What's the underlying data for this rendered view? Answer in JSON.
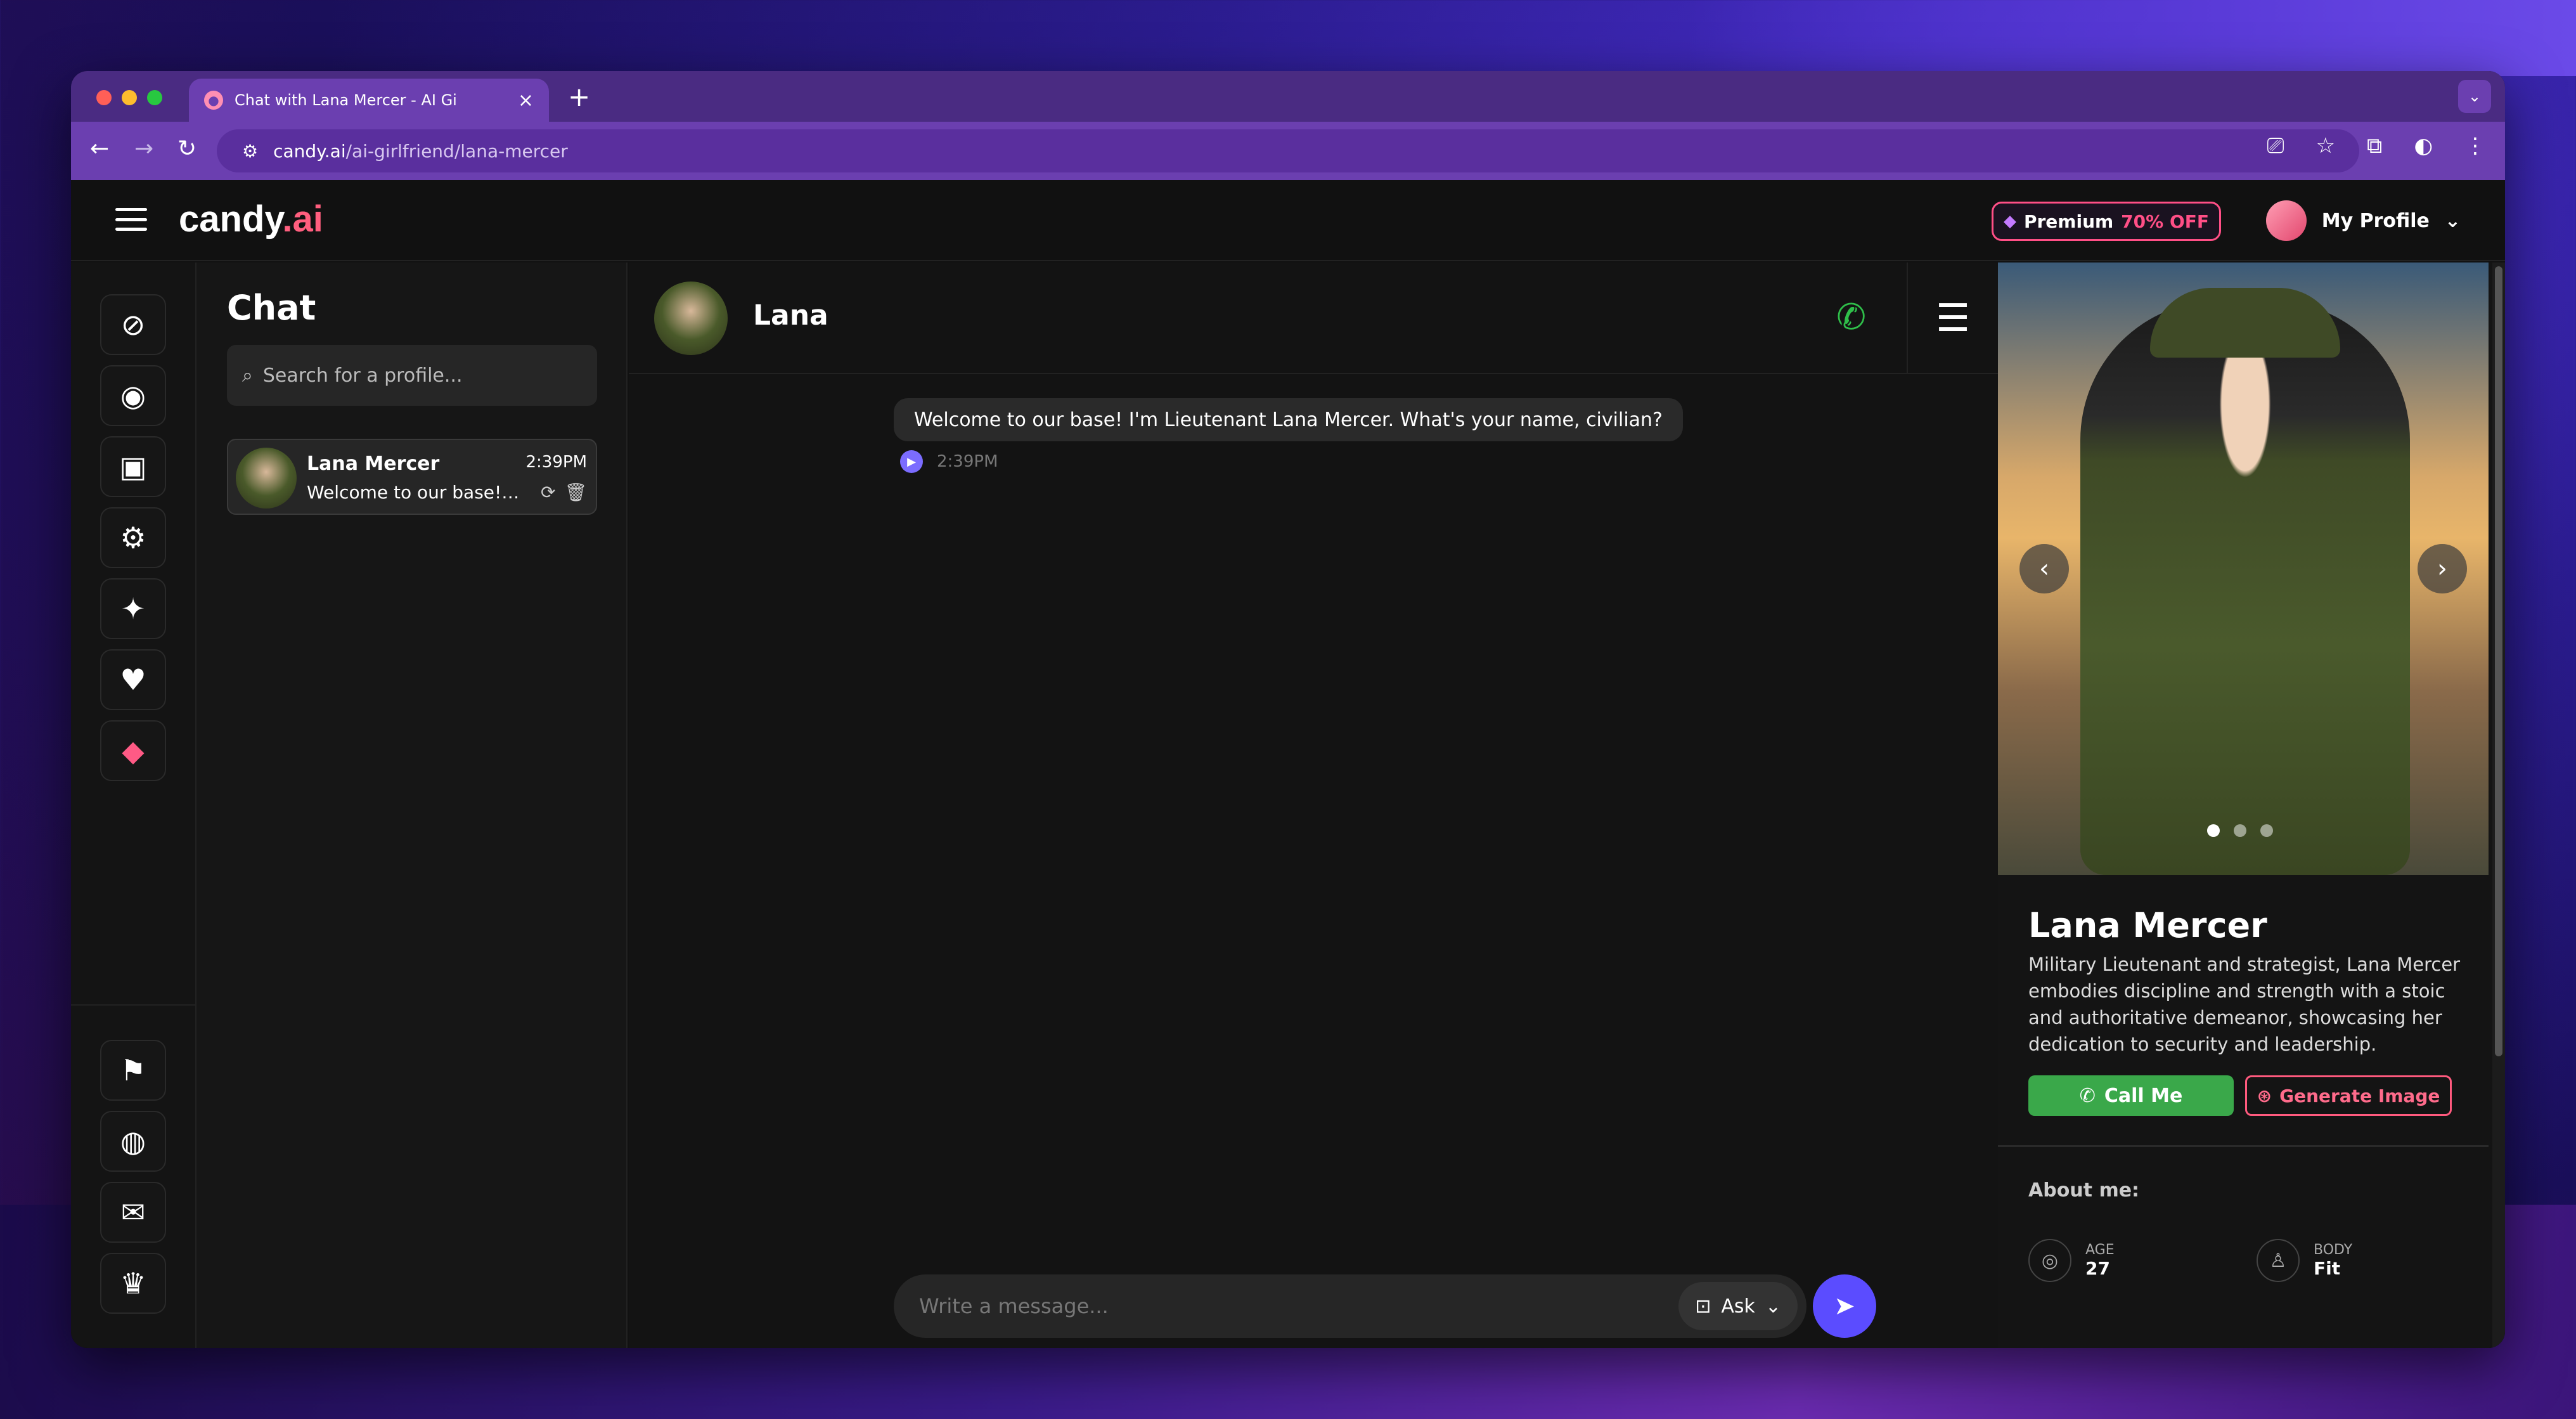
{
  "browser": {
    "tab_title": "Chat with Lana Mercer - AI Gi",
    "url_domain": "candy.ai",
    "url_path": "/ai-girlfriend/lana-mercer"
  },
  "topbar": {
    "logo_main": "candy",
    "logo_suffix": ".ai",
    "premium_label": "Premium",
    "premium_discount": "70% OFF",
    "profile_label": "My Profile"
  },
  "chatlist": {
    "heading": "Chat",
    "search_placeholder": "Search for a profile...",
    "items": [
      {
        "name": "Lana Mercer",
        "time": "2:39PM",
        "preview": "Welcome to our base! I'm Lieutenant Lana Mercer. What's your name, civilian?"
      }
    ]
  },
  "conversation": {
    "name": "Lana",
    "messages": [
      {
        "text": "Welcome to our base! I'm Lieutenant Lana Mercer. What's your name, civilian?",
        "time": "2:39PM"
      }
    ],
    "composer_placeholder": "Write a message...",
    "ask_label": "Ask"
  },
  "profile_panel": {
    "name": "Lana Mercer",
    "description": "Military Lieutenant and strategist, Lana Mercer embodies discipline and strength with a stoic and authoritative demeanor, showcasing her dedication to security and leadership.",
    "call_label": "Call Me",
    "generate_label": "Generate Image",
    "about_heading": "About me:",
    "attributes": [
      {
        "label": "AGE",
        "value": "27"
      },
      {
        "label": "BODY",
        "value": "Fit"
      }
    ]
  },
  "colors": {
    "accent_pink": "#ff5e7e",
    "call_green": "#2fbf4a",
    "send_blue": "#5b4cff",
    "browser_purple": "#6b3fb0"
  }
}
